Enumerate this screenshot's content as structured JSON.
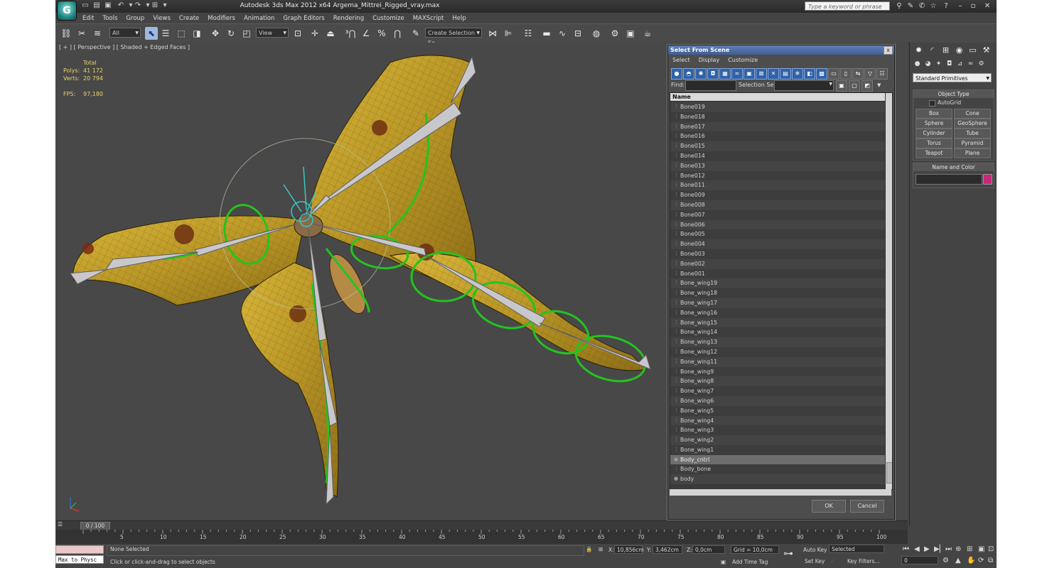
{
  "window": {
    "title": "Autodesk 3ds Max  2012 x64      Argema_Mittrei_Rigged_vray.max",
    "search_placeholder": "Type a keyword or phrase"
  },
  "menu": [
    "Edit",
    "Tools",
    "Group",
    "Views",
    "Create",
    "Modifiers",
    "Animation",
    "Graph Editors",
    "Rendering",
    "Customize",
    "MAXScript",
    "Help"
  ],
  "toolbar": {
    "selection_filter": "All",
    "reference_coord": "View",
    "named_selection": "Create Selection Se"
  },
  "viewport": {
    "label": "[ + ] [ Perspective ] [ Shaded + Edged Faces ]",
    "stats": {
      "total_label": "Total",
      "polys_label": "Polys:",
      "polys_value": "41 172",
      "verts_label": "Verts:",
      "verts_value": "20 794",
      "fps_label": "FPS:",
      "fps_value": "97,180"
    }
  },
  "dialog": {
    "title": "Select From Scene",
    "close": "x",
    "menu": [
      "Select",
      "Display",
      "Customize"
    ],
    "find_label": "Find:",
    "selection_set_label": "Selection Set:",
    "column_header": "Name",
    "items": [
      "Bone019",
      "Bone018",
      "Bone017",
      "Bone016",
      "Bone015",
      "Bone014",
      "Bone013",
      "Bone012",
      "Bone011",
      "Bone009",
      "Bone008",
      "Bone007",
      "Bone006",
      "Bone005",
      "Bone004",
      "Bone003",
      "Bone002",
      "Bone001",
      "Bone_wing19",
      "Bone_wing18",
      "Bone_wing17",
      "Bone_wing16",
      "Bone_wing15",
      "Bone_wing14",
      "Bone_wing13",
      "Bone_wing12",
      "Bone_wing11",
      "Bone_wing9",
      "Bone_wing8",
      "Bone_wing7",
      "Bone_wing6",
      "Bone_wing5",
      "Bone_wing4",
      "Bone_wing3",
      "Bone_wing2",
      "Bone_wing1",
      "Body_cntrl",
      "Body_bone",
      "body"
    ],
    "selected_item": "Body_cntrl",
    "ok_label": "OK",
    "cancel_label": "Cancel"
  },
  "command_panel": {
    "category": "Standard Primitives",
    "object_type_header": "Object Type",
    "autogrid_label": "AutoGrid",
    "buttons": [
      "Box",
      "Cone",
      "Sphere",
      "GeoSphere",
      "Cylinder",
      "Tube",
      "Torus",
      "Pyramid",
      "Teapot",
      "Plane"
    ],
    "name_color_header": "Name and Color",
    "color_swatch": "#c8287a"
  },
  "timeline": {
    "slider_label": "0 / 100",
    "ticks": [
      "5",
      "10",
      "15",
      "20",
      "25",
      "30",
      "35",
      "40",
      "45",
      "50",
      "55",
      "60",
      "65",
      "70",
      "75",
      "80",
      "85",
      "90",
      "95",
      "100"
    ]
  },
  "status": {
    "maxscript_listener": "Max to Physc",
    "selection": "None Selected",
    "prompt": "Click or click-and-drag to select objects",
    "x_label": "X:",
    "x_value": "10,856cm",
    "y_label": "Y:",
    "y_value": "3,462cm",
    "z_label": "Z:",
    "z_value": "0,0cm",
    "grid": "Grid = 10,0cm",
    "add_time_tag": "Add Time Tag",
    "auto_key": "Auto Key",
    "set_key": "Set Key",
    "key_mode": "Selected",
    "key_filters": "Key Filters...",
    "frame": "0"
  }
}
